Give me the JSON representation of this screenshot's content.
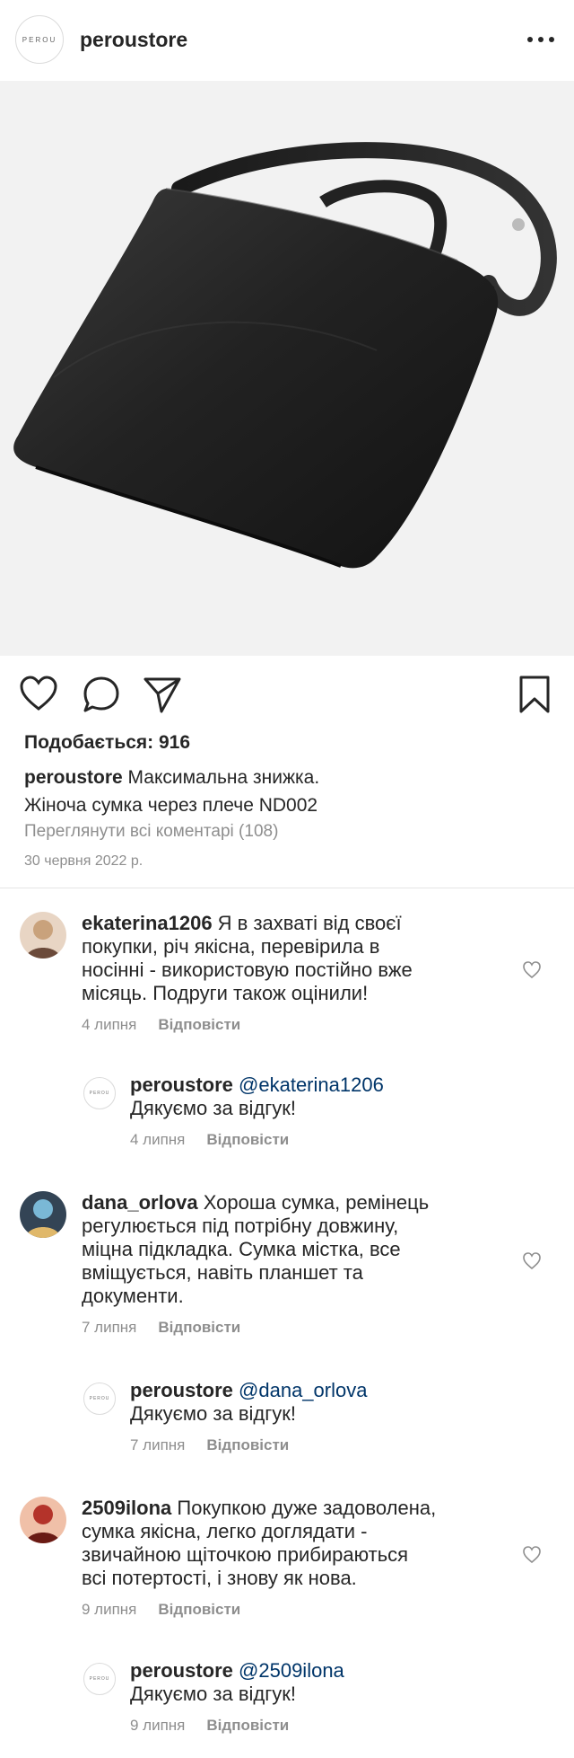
{
  "header": {
    "logo_text": "PEROU",
    "username": "peroustore"
  },
  "post": {
    "likes": "Подобається: 916",
    "caption_user": "peroustore",
    "caption_line1": "Максимальна знижка.",
    "caption_line2": "Жіноча сумка через плече ND002",
    "view_all": "Переглянути всі коментарі (108)",
    "date": "30 червня 2022 р."
  },
  "comments": [
    {
      "user": "ekaterina1206",
      "text": "Я в захваті від своєї покупки, річ якісна, перевірила в носінні - використовую постійно вже місяць. Подруги також оцінили!",
      "date": "4 липня",
      "reply_label": "Відповісти",
      "lines": [
        "Я в захваті від своєї",
        "покупки, річ якісна, перевірила в",
        "носінні - використовую постійно вже",
        "місяць. Подруги також оцінили!"
      ],
      "response": {
        "user": "peroustore",
        "mention": "@ekaterina1206",
        "text": "Дякуємо за відгук!",
        "date": "4 липня",
        "reply_label": "Відповісти"
      }
    },
    {
      "user": "dana_orlova",
      "text": "Хороша сумка, ремінець регулюється під потрібну довжину, міцна підкладка. Сумка містка, все вміщується, навіть планшет та документи.",
      "date": "7 липня",
      "reply_label": "Відповісти",
      "lines": [
        "Хороша сумка, ремінець",
        "регулюється під потрібну довжину,",
        "міцна підкладка. Сумка містка, все",
        "вміщується, навіть планшет та",
        "документи."
      ],
      "response": {
        "user": "peroustore",
        "mention": "@dana_orlova",
        "text": "Дякуємо за відгук!",
        "date": "7 липня",
        "reply_label": "Відповісти"
      }
    },
    {
      "user": "2509ilona",
      "text": "Покупкою дуже задоволена, сумка якісна, легко доглядати - звичайною щіточкою прибираються всі потертості, і знову як нова.",
      "date": "9 липня",
      "reply_label": "Відповісти",
      "lines": [
        "Покупкою дуже задоволена,",
        "сумка якісна, легко доглядати -",
        "звичайною щіточкою прибираються",
        "всі потертості, і знову як нова."
      ],
      "response": {
        "user": "peroustore",
        "mention": "@2509ilona",
        "text": "Дякуємо за відгук!",
        "date": "9 липня",
        "reply_label": "Відповісти"
      }
    }
  ],
  "icons": {
    "like": "heart-icon",
    "comment": "comment-icon",
    "share": "paper-plane-icon",
    "save": "bookmark-icon",
    "more": "more-dots-icon"
  }
}
